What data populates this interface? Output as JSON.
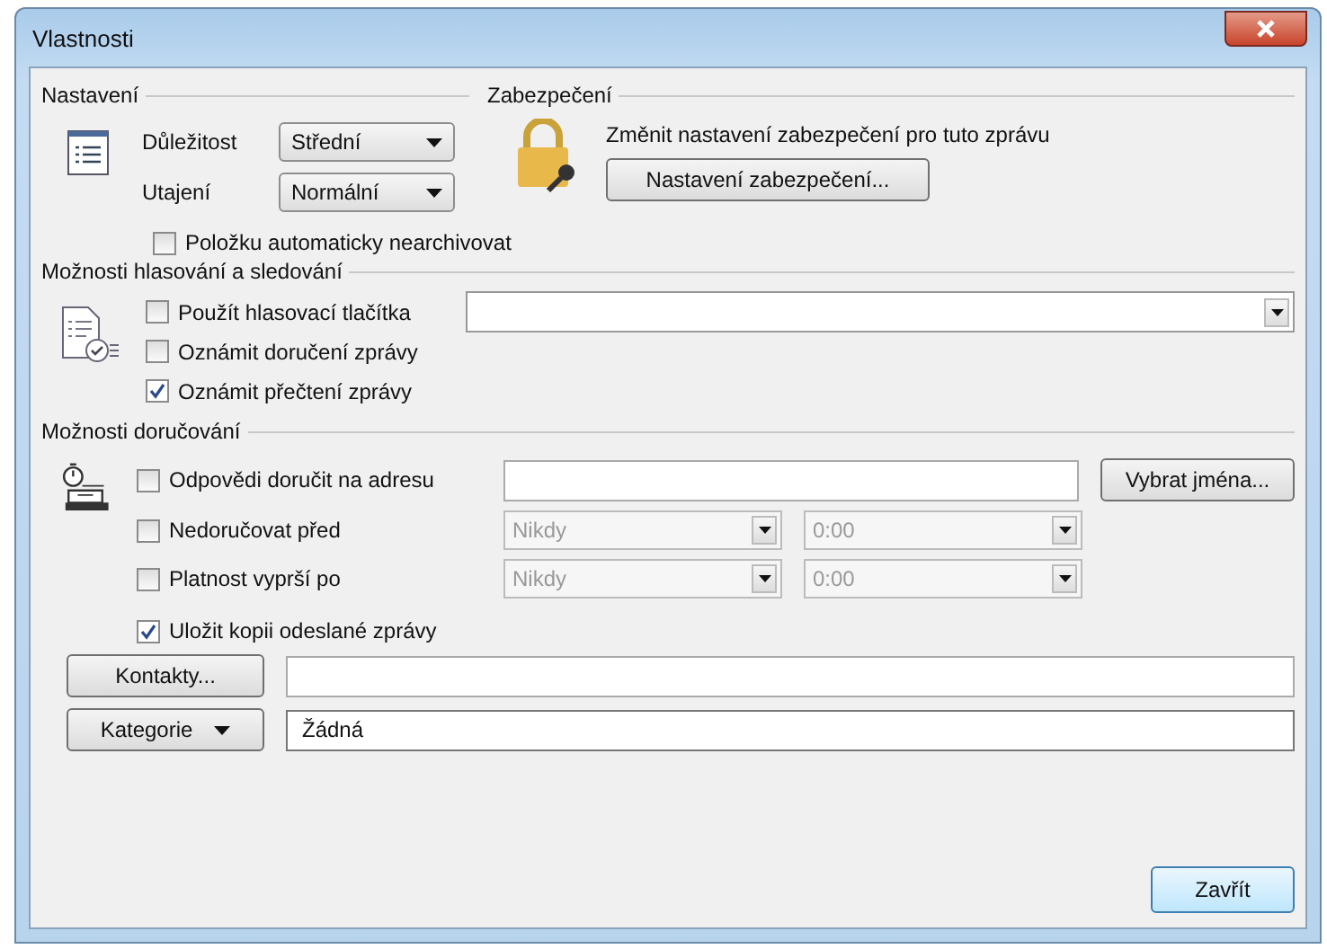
{
  "window": {
    "title": "Vlastnosti"
  },
  "settings": {
    "heading": "Nastavení",
    "importance": {
      "label": "Důležitost",
      "value": "Střední"
    },
    "sensitivity": {
      "label": "Utajení",
      "value": "Normální"
    },
    "do_not_archive": {
      "label": "Položku automaticky nearchivovat",
      "checked": false
    }
  },
  "security": {
    "heading": "Zabezpečení",
    "text": "Změnit nastavení zabezpečení pro tuto zprávu",
    "button": "Nastavení zabezpečení..."
  },
  "voting": {
    "heading": "Možnosti hlasování a sledování",
    "options": [
      {
        "label": "Použít hlasovací tlačítka",
        "checked": false
      },
      {
        "label": "Oznámit doručení zprávy",
        "checked": false
      },
      {
        "label": "Oznámit přečtení zprávy",
        "checked": true
      }
    ]
  },
  "delivery": {
    "heading": "Možnosti doručování",
    "reply_to": {
      "label": "Odpovědi doručit na adresu",
      "checked": false,
      "button": "Vybrat jména..."
    },
    "schedule": [
      {
        "label": "Nedoručovat před",
        "checked": false,
        "date": "Nikdy",
        "time": "0:00"
      },
      {
        "label": "Platnost vyprší po",
        "checked": false,
        "date": "Nikdy",
        "time": "0:00"
      }
    ],
    "save_copy": {
      "label": "Uložit kopii odeslané zprávy",
      "checked": true
    }
  },
  "contacts": {
    "button": "Kontakty..."
  },
  "categories": {
    "button": "Kategorie",
    "value": "Žádná"
  },
  "close_button": "Zavřít"
}
